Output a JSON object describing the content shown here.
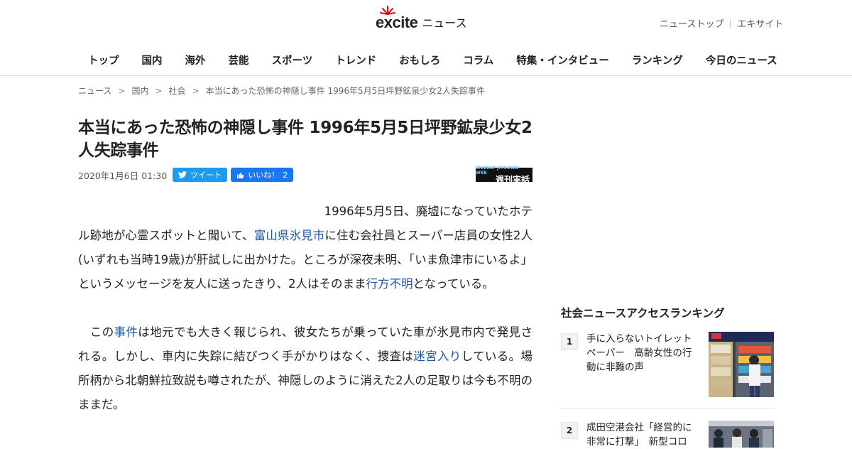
{
  "site": {
    "logo_text": "excite",
    "logo_sub": "ニュース",
    "top_links": [
      "ニューストップ",
      "エキサイト"
    ],
    "top_links_separator": "｜",
    "accent_color": "#e60012"
  },
  "nav": [
    "トップ",
    "国内",
    "海外",
    "芸能",
    "スポーツ",
    "トレンド",
    "おもしろ",
    "コラム",
    "特集・インタビュー",
    "ランキング",
    "今日のニュース"
  ],
  "breadcrumb": {
    "separator": ">",
    "items": [
      "ニュース",
      "国内",
      "社会",
      "本当にあった恐怖の神隠し事件 1996年5月5日坪野鉱泉少女2人失踪事件"
    ]
  },
  "article": {
    "title": "本当にあった恐怖の神隠し事件 1996年5月5日坪野鉱泉少女2人失踪事件",
    "date": "2020年1月6日 01:30",
    "tweet_label": "ツイート",
    "like_label": "いいね！",
    "like_count": "2",
    "source_small": "WEEKLY JITSUWA WEB",
    "source_name": "週刊実話",
    "p1": {
      "lead": "　　　　　　　　　　　　　　　　　　　　　1996年5月5日、廃墟になっていたホテル跡地が心霊スポットと聞いて、",
      "link1": "富山県氷見市",
      "mid": "に住む会社員とスーパー店員の女性2人(いずれも当時19歳)が肝試しに出かけた。ところが深夜未明、「いま魚津市にいるよ」というメッセージを友人に送ったきり、2人はそのまま",
      "link2": "行方不明",
      "end": "となっている。"
    },
    "p2": {
      "lead": "　この",
      "link1": "事件",
      "mid": "は地元でも大きく報じられ、彼女たちが乗っていた車が氷見市内で発見される。しかし、車内に失踪に結びつく手がかりはなく、捜査は",
      "link2": "迷宮入り",
      "end": "している。場所柄から北朝鮮拉致説も噂されたが、神隠しのように消えた2人の足取りは今も不明のままだ。"
    }
  },
  "sidebar": {
    "ranking_title": "社会ニュースアクセスランキング",
    "items": [
      {
        "rank": "1",
        "text": "手に入らないトイレットペーパー　高齢女性の行動に非難の声"
      },
      {
        "rank": "2",
        "text": "成田空港会社「経営的に非常に打撃」　新型コロ"
      }
    ]
  }
}
